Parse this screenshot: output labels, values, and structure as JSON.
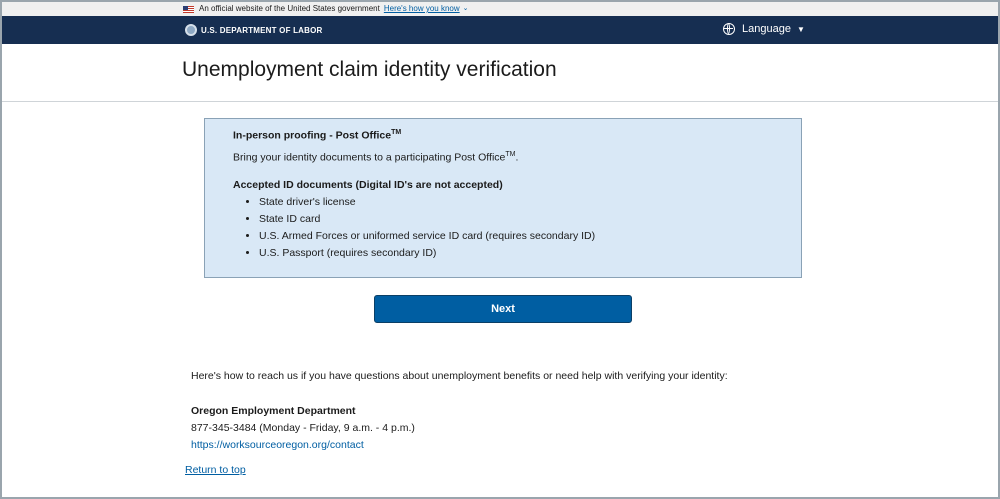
{
  "gov_banner": {
    "text": "An official website of the United States government",
    "link": "Here's how you know"
  },
  "header": {
    "agency": "U.S. DEPARTMENT OF LABOR",
    "language": "Language"
  },
  "page_title": "Unemployment claim identity verification",
  "info_box": {
    "heading": "In-person proofing - Post Office",
    "heading_tm": "TM",
    "body": "Bring your identity documents to a participating Post Office",
    "body_tm": "TM",
    "body_end": ".",
    "docs_heading": "Accepted ID documents (Digital ID's are not accepted)",
    "docs": [
      "State driver's license",
      "State ID card",
      "U.S. Armed Forces or uniformed service ID card (requires secondary ID)",
      "U.S. Passport (requires secondary ID)"
    ]
  },
  "next_button": "Next",
  "contact": {
    "intro": "Here's how to reach us if you have questions about unemployment benefits or need help with verifying your identity:",
    "org": "Oregon Employment Department",
    "phone": "877-345-3484 (Monday - Friday, 9 a.m. - 4 p.m.)",
    "url": "https://worksourceoregon.org/contact"
  },
  "return_to_top": "Return to top"
}
